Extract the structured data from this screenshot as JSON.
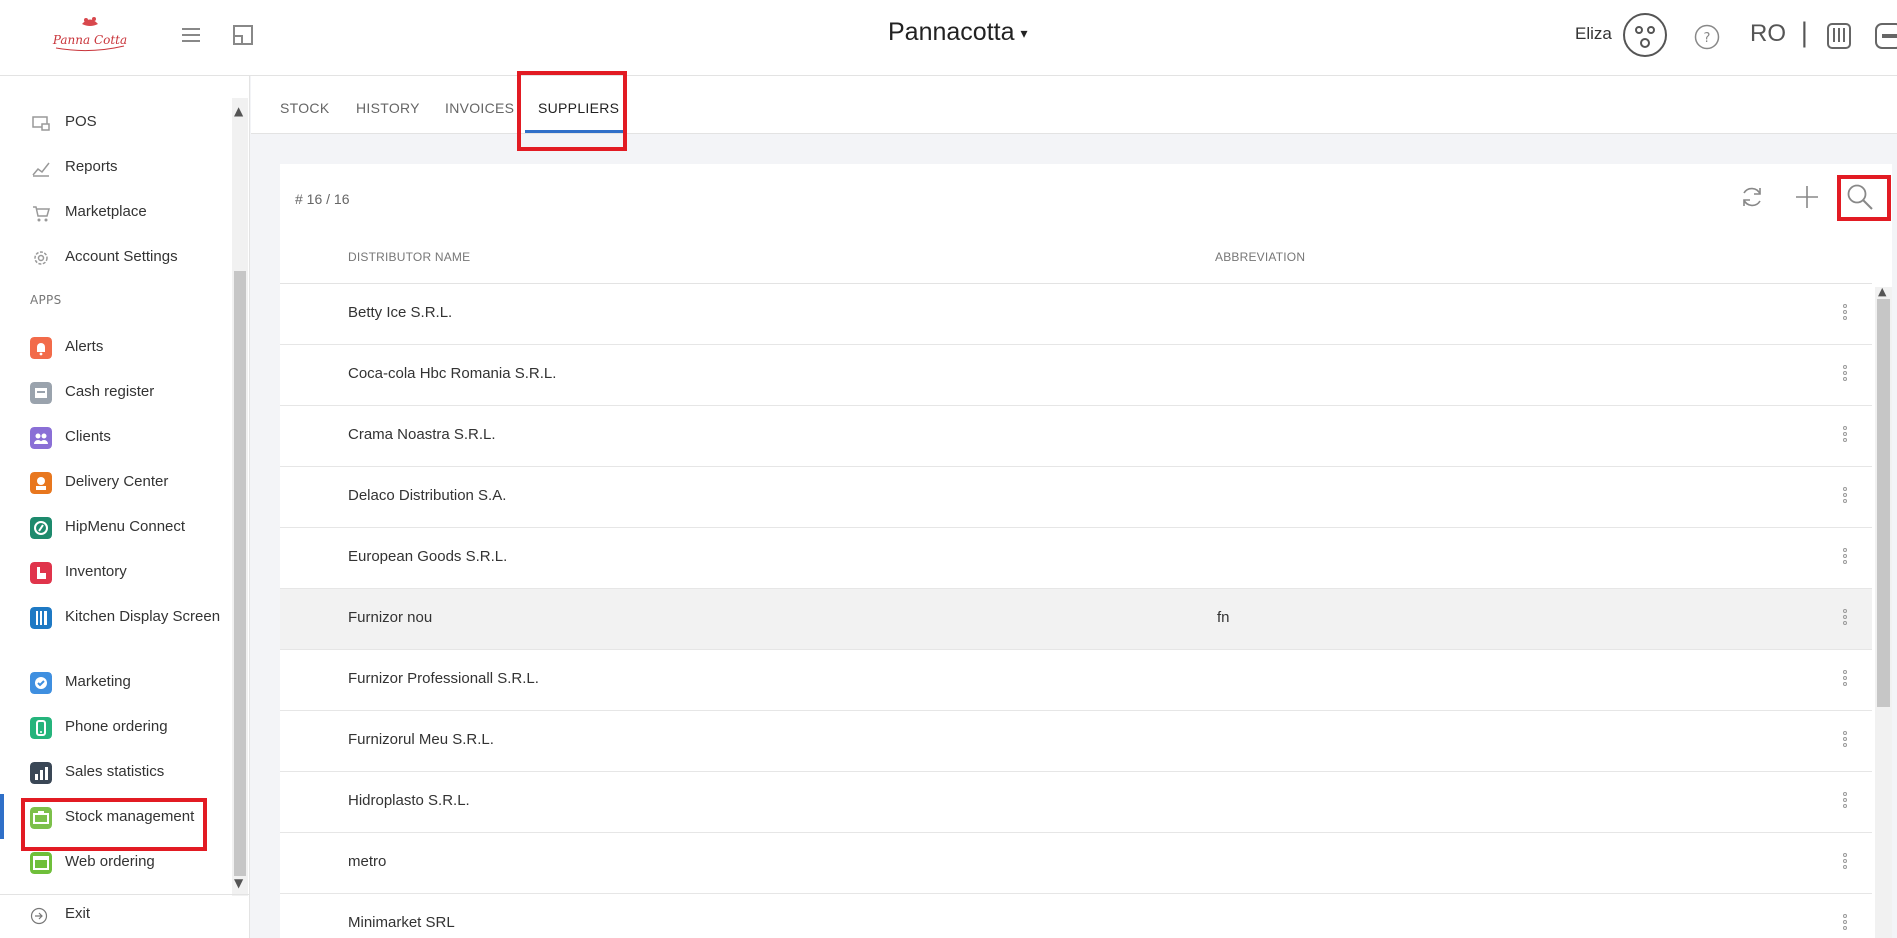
{
  "header": {
    "logo_text": "Panna Cotta",
    "venue": "Pannacotta",
    "user_name": "Eliza",
    "language": "RO",
    "separator": "|"
  },
  "sidebar": {
    "top_items": [
      {
        "label": "POS",
        "icon": "pos-icon"
      },
      {
        "label": "Reports",
        "icon": "reports-icon"
      },
      {
        "label": "Marketplace",
        "icon": "cart-icon"
      },
      {
        "label": "Account Settings",
        "icon": "gear-icon"
      }
    ],
    "apps_heading": "APPS",
    "apps": [
      {
        "label": "Alerts",
        "icon": "bell-icon",
        "color": "#f26b4a"
      },
      {
        "label": "Cash register",
        "icon": "cash-register-icon",
        "color": "#9aa3ad"
      },
      {
        "label": "Clients",
        "icon": "clients-icon",
        "color": "#8a6fd6"
      },
      {
        "label": "Delivery Center",
        "icon": "delivery-icon",
        "color": "#e8771e"
      },
      {
        "label": "HipMenu Connect",
        "icon": "hipmenu-icon",
        "color": "#1d8a6d"
      },
      {
        "label": "Inventory",
        "icon": "inventory-icon",
        "color": "#e0344b"
      },
      {
        "label": "Kitchen Display Screen",
        "icon": "kitchen-icon",
        "color": "#1e79c4"
      },
      {
        "label": "Marketing",
        "icon": "marketing-icon",
        "color": "#3f8fe0"
      },
      {
        "label": "Phone ordering",
        "icon": "phone-icon",
        "color": "#25b47c"
      },
      {
        "label": "Sales statistics",
        "icon": "statistics-icon",
        "color": "#3a4756"
      },
      {
        "label": "Stock management",
        "icon": "stock-icon",
        "color": "#7cc04a"
      },
      {
        "label": "Web ordering",
        "icon": "web-icon",
        "color": "#6fbf3a"
      }
    ],
    "exit_label": "Exit"
  },
  "tabs": [
    {
      "label": "STOCK"
    },
    {
      "label": "HISTORY"
    },
    {
      "label": "INVOICES"
    },
    {
      "label": "SUPPLIERS"
    }
  ],
  "suppliers": {
    "count": "# 16 / 16",
    "columns": {
      "name": "DISTRIBUTOR NAME",
      "abbreviation": "ABBREVIATION"
    },
    "rows": [
      {
        "name": "Betty Ice S.R.L.",
        "abbreviation": ""
      },
      {
        "name": "Coca-cola Hbc Romania S.R.L.",
        "abbreviation": ""
      },
      {
        "name": "Crama Noastra S.R.L.",
        "abbreviation": ""
      },
      {
        "name": "Delaco Distribution S.A.",
        "abbreviation": ""
      },
      {
        "name": "European Goods S.R.L.",
        "abbreviation": ""
      },
      {
        "name": "Furnizor nou",
        "abbreviation": "fn"
      },
      {
        "name": "Furnizor Professionall S.R.L.",
        "abbreviation": ""
      },
      {
        "name": "Furnizorul Meu S.R.L.",
        "abbreviation": ""
      },
      {
        "name": "Hidroplasto S.R.L.",
        "abbreviation": ""
      },
      {
        "name": "metro",
        "abbreviation": ""
      },
      {
        "name": "Minimarket SRL",
        "abbreviation": ""
      }
    ]
  },
  "colors": {
    "accent": "#2f6fc8",
    "highlight_box": "#e21b23",
    "row_hover": "#f2f2f2"
  }
}
